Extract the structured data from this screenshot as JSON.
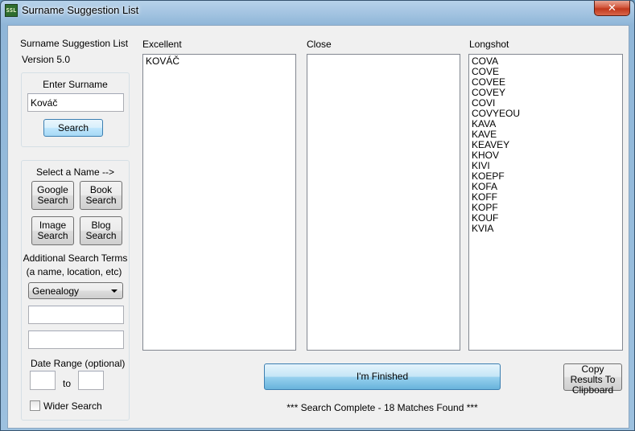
{
  "window": {
    "title": "Surname Suggestion List",
    "icon_label": "SSL",
    "close_glyph": "✕"
  },
  "app": {
    "name": "Surname Suggestion List",
    "version": "Version 5.0"
  },
  "surname_box": {
    "label": "Enter Surname",
    "value": "Kováč",
    "search_button": "Search"
  },
  "select_box": {
    "heading": "Select a Name -->",
    "buttons": {
      "google": "Google Search",
      "book": "Book Search",
      "image": "Image Search",
      "blog": "Blog Search"
    },
    "additional_terms_label": "Additional Search Terms",
    "additional_terms_hint": "(a name, location, etc)",
    "category_selected": "Genealogy",
    "term1_value": "",
    "term2_value": "",
    "date_range_label": "Date Range (optional)",
    "date_from": "",
    "date_to_label": "to",
    "date_to": "",
    "wider_search_label": "Wider Search",
    "wider_search_checked": false
  },
  "columns": {
    "excellent": {
      "label": "Excellent",
      "items": [
        "KOVÁČ"
      ]
    },
    "close": {
      "label": "Close",
      "items": []
    },
    "longshot": {
      "label": "Longshot",
      "items": [
        "COVA",
        "COVE",
        "COVEE",
        "COVEY",
        "COVI",
        "COVYEOU",
        "KAVA",
        "KAVE",
        "KEAVEY",
        "KHOV",
        "KIVI",
        "KOEPF",
        "KOFA",
        "KOFF",
        "KOPF",
        "KOUF",
        "KVIA"
      ]
    }
  },
  "footer": {
    "finished_button": "I'm Finished",
    "copy_button": "Copy Results To Clipboard",
    "status": "*** Search Complete - 18 Matches Found ***"
  },
  "colors": {
    "title_bar": "#9dc1df",
    "close_button": "#c0381c",
    "face": "#f0f0f0",
    "accent_button": "#68b3db"
  }
}
